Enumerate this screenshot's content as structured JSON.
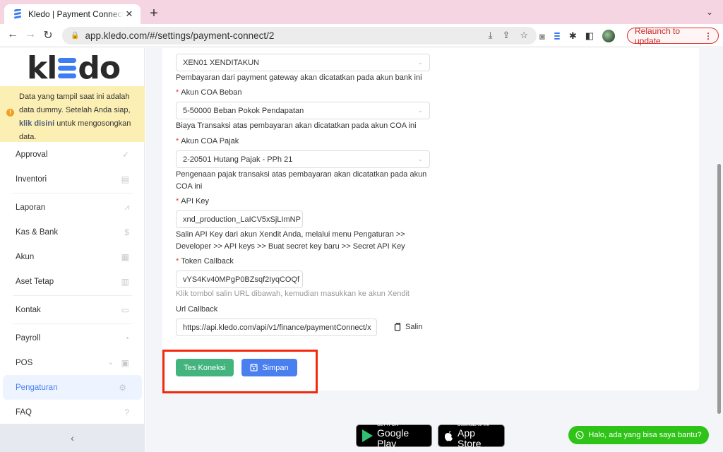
{
  "browser": {
    "tab_title": "Kledo | Payment Connect Xendit",
    "url": "app.kledo.com/#/settings/payment-connect/2",
    "relaunch_label": "Relaunch to update",
    "icons": {
      "back": "←",
      "forward": "→",
      "reload": "↻",
      "lock": "🔒",
      "close": "✕",
      "new_tab": "+",
      "dropdown": "⌄",
      "install": "⤓",
      "share": "⇪",
      "star": "☆",
      "camera": "◙",
      "puzzle": "✱",
      "sidepanel": "◧",
      "menu": "⋮"
    }
  },
  "sidebar": {
    "logo_prefix": "kl",
    "logo_suffix": "do",
    "notice": {
      "text_before": "Data yang tampil saat ini adalah data dummy. Setelah Anda siap, ",
      "link": "klik disini",
      "text_after": " untuk mengosongkan data.",
      "icon": "!"
    },
    "items": [
      {
        "label": "Approval",
        "icon": "✓"
      },
      {
        "label": "Inventori",
        "icon": "▤"
      },
      {
        "label": "Laporan",
        "icon": "⩘"
      },
      {
        "label": "Kas & Bank",
        "icon": "$"
      },
      {
        "label": "Akun",
        "icon": "▦"
      },
      {
        "label": "Aset Tetap",
        "icon": "▥"
      },
      {
        "label": "Kontak",
        "icon": "▭"
      },
      {
        "label": "Payroll",
        "icon": "◔"
      },
      {
        "label": "POS",
        "icon": "▣",
        "chevron": "⌄"
      },
      {
        "label": "Pengaturan",
        "icon": "⚙",
        "active": true
      },
      {
        "label": "FAQ",
        "icon": "?"
      }
    ],
    "collapse_icon": "‹"
  },
  "form": {
    "bank_account": {
      "value": "XEN01 XENDITAKUN",
      "help": "Pembayaran dari payment gateway akan dicatatkan pada akun bank ini"
    },
    "coa_beban": {
      "label": "Akun COA Beban",
      "value": "5-50000 Beban Pokok Pendapatan",
      "help": "Biaya Transaksi atas pembayaran akan dicatatkan pada akun COA ini"
    },
    "coa_pajak": {
      "label": "Akun COA Pajak",
      "value": "2-20501 Hutang Pajak - PPh 21",
      "help": "Pengenaan pajak transaksi atas pembayaran akan dicatatkan pada akun COA ini"
    },
    "api_key": {
      "label": "API Key",
      "value": "xnd_production_LaICV5xSjLImNP",
      "help": "Salin API Key dari akun Xendit Anda, melalui menu Pengaturan >> Developer >> API keys >> Buat secret key baru >> Secret API Key"
    },
    "token_callback": {
      "label": "Token Callback",
      "value": "vYS4Kv40MPgP0BZsqf2IyqCOQf",
      "help": "Klik tombol salin URL dibawah, kemudian masukkan ke akun Xendit"
    },
    "url_callback": {
      "label": "Url Callback",
      "value": "https://api.kledo.com/api/v1/finance/paymentConnect/x",
      "copy_label": "Salin"
    },
    "required_mark": "*",
    "select_chevron": "⌄",
    "test_button": "Tes Koneksi",
    "save_button": "Simpan"
  },
  "footer": {
    "google_play_small": "GET IT ON",
    "google_play_big": "Google Play",
    "app_store_small": "Download on the",
    "app_store_big": "App Store",
    "whatsapp_label": "Halo, ada yang bisa saya bantu?"
  },
  "colors": {
    "primary": "#4a7ff0",
    "success": "#44b47f",
    "whatsapp": "#2ec317",
    "highlight": "#f5280e",
    "notice_bg": "#fcefb4"
  }
}
